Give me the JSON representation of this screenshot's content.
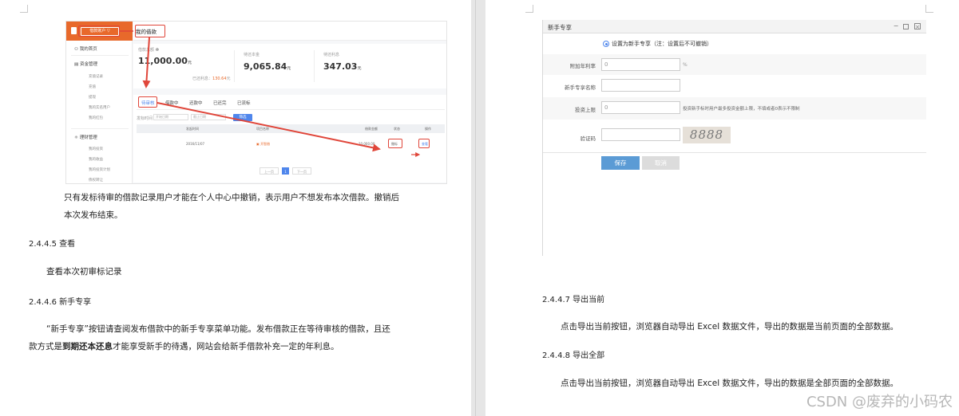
{
  "left_page": {
    "screenshot": {
      "sidebar": {
        "account_tag": "借款账户 ▽",
        "items": [
          "我的首页",
          "资金管理",
          "理财管理"
        ],
        "sub_items_funds": [
          "充值记录",
          "充值",
          "提现",
          "我的实名用户",
          "我的红包"
        ],
        "sub_items_invest": [
          "我的投资",
          "我的收益",
          "我的投资计划",
          "债权转让"
        ]
      },
      "header_title": "我的借款",
      "summary": {
        "borrow_total_label": "借款总额 ❶",
        "borrow_total": "11,000.00",
        "borrow_total_unit": "元",
        "repaid_prefix": "已还利息：",
        "repaid_value": "130.64",
        "repaid_suffix": "元",
        "principal_label": "待还本金",
        "principal": "9,065.84",
        "principal_unit": "元",
        "interest_label": "待还利息",
        "interest": "347.03",
        "interest_unit": "元"
      },
      "tabs": [
        "待审核",
        "借款中",
        "还款中",
        "已还完",
        "已流标"
      ],
      "filter": {
        "label": "发标时间",
        "start_placeholder": "开始日期",
        "end_placeholder": "截止日期",
        "button": "筛选"
      },
      "table": {
        "headers": [
          "发起时间",
          "项目名称",
          "借款金额",
          "状态",
          "操作"
        ],
        "row": {
          "date": "2016/11/07",
          "name": "开智借",
          "amount": "10,000.00",
          "status": "撤标",
          "action": "查看"
        }
      },
      "pager": {
        "prev": "上一页",
        "current": "1",
        "next": "下一页"
      }
    },
    "caption_line1": "只有发标待审的借款记录用户才能在个人中心中撤销，表示用户不想发布本次借款。撤销后",
    "caption_line2": "本次发布结束。",
    "section_view": "2.4.4.5  查看",
    "section_view_body": "查看本次初审标记录",
    "section_newbie": "2.4.4.6  新手专享",
    "newbie_body_line1": "“新手专享”按钮请查阅发布借款中的新手专享菜单功能。发布借款正在等待审核的借款，且还",
    "newbie_body_line2_pre": "款方式是",
    "newbie_body_line2_bold": "到期还本还息",
    "newbie_body_line2_post": "才能享受新手的待遇，网站会给新手借款补充一定的年利息。"
  },
  "right_page": {
    "dialog": {
      "title": "新手专享",
      "radio_label": "设置为新手专享（注：设置后不可撤销）",
      "fields": [
        {
          "label": "附加年利率",
          "value": "0",
          "suffix": "%"
        },
        {
          "label": "新手专享名称",
          "value": "",
          "suffix": ""
        },
        {
          "label": "投资上限",
          "value": "0",
          "suffix": "投资新手标时用户最多投资金额上限，不填或者0表示不限制"
        },
        {
          "label": "验证码",
          "value": "",
          "suffix": ""
        }
      ],
      "captcha": "8888",
      "save": "保存",
      "cancel": "取消"
    },
    "section_export_current": "2.4.4.7  导出当前",
    "export_current_body": "点击导出当前按钮，浏览器自动导出 Excel 数据文件，导出的数据是当前页面的全部数据。",
    "section_export_all": "2.4.4.8  导出全部",
    "export_all_body": "点击导出当前按钮，浏览器自动导出 Excel 数据文件，导出的数据是全部页面的全部数据。",
    "watermark": "CSDN @废弃的小码农"
  }
}
